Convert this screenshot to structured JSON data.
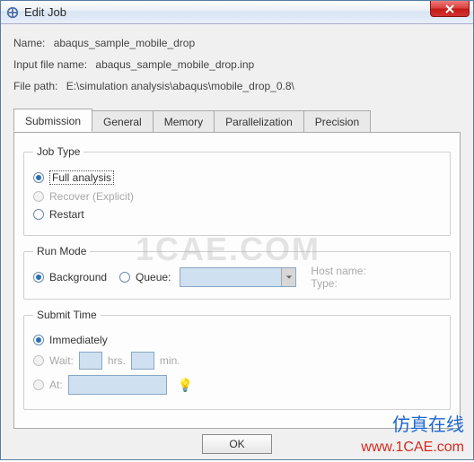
{
  "window": {
    "title": "Edit Job"
  },
  "info": {
    "name_label": "Name:",
    "name_value": "abaqus_sample_mobile_drop",
    "inputfile_label": "Input file name:",
    "inputfile_value": "abaqus_sample_mobile_drop.inp",
    "filepath_label": "File path:",
    "filepath_value": "E:\\simulation analysis\\abaqus\\mobile_drop_0.8\\"
  },
  "tabs": {
    "submission": "Submission",
    "general": "General",
    "memory": "Memory",
    "parallel": "Parallelization",
    "precision": "Precision"
  },
  "jobtype": {
    "legend": "Job Type",
    "full": "Full analysis",
    "recover": "Recover (Explicit)",
    "restart": "Restart"
  },
  "runmode": {
    "legend": "Run Mode",
    "background": "Background",
    "queue": "Queue:",
    "host_label": "Host name:",
    "type_label": "Type:",
    "queue_value": ""
  },
  "submittime": {
    "legend": "Submit Time",
    "immediately": "Immediately",
    "wait": "Wait:",
    "hrs": "hrs.",
    "min": "min.",
    "at": "At:",
    "hrs_value": "",
    "min_value": "",
    "at_value": ""
  },
  "buttons": {
    "ok": "OK"
  },
  "watermark": {
    "center": "1CAE.COM",
    "cn": "仿真在线",
    "url": "www.1CAE.com"
  }
}
